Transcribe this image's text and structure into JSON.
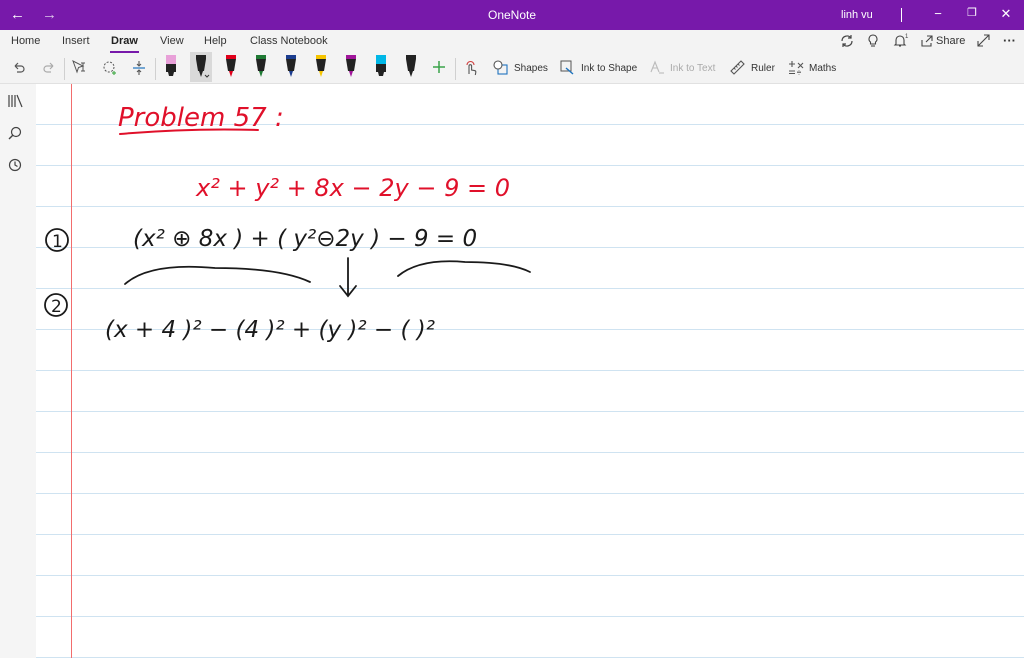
{
  "titlebar": {
    "back": "←",
    "forward": "→",
    "app_title": "OneNote",
    "user": "linh vu",
    "minimize": "−",
    "restore": "❐",
    "close": "✕"
  },
  "tabs": [
    "Home",
    "Insert",
    "Draw",
    "View",
    "Help",
    "Class Notebook"
  ],
  "active_tab": "Draw",
  "ribbon_right": {
    "share_label": "Share",
    "more": "···"
  },
  "tools": {
    "shapes": "Shapes",
    "ink_to_shape": "Ink to Shape",
    "ink_to_text": "Ink to Text",
    "ruler": "Ruler",
    "maths": "Maths"
  },
  "pens": [
    {
      "color": "#e8a0d8",
      "kind": "highlighter"
    },
    {
      "color": "#222222",
      "kind": "pen-selected"
    },
    {
      "color": "#e0001b",
      "kind": "pen"
    },
    {
      "color": "#1f7a34",
      "kind": "pen"
    },
    {
      "color": "#1c3d8f",
      "kind": "pen"
    },
    {
      "color": "#f5c400",
      "kind": "pen"
    },
    {
      "color": "#a0169a",
      "kind": "pen"
    },
    {
      "color": "#00b7e6",
      "kind": "highlighter"
    },
    {
      "color": "#222222",
      "kind": "pen"
    }
  ],
  "ink_colors": {
    "red": "#e0102a",
    "black": "#1a1a1a"
  },
  "note": {
    "title": "Problem 57 :",
    "equation": "x² + y² + 8x − 2y − 9 = 0",
    "step1_marker": "1",
    "step1": "(x² ⊕ 8x )  +  ( y²⊖2y )  − 9 = 0",
    "step2_marker": "2",
    "step2": "(x + 4 )² − (4 )² +  (y   )² − ( )²"
  }
}
